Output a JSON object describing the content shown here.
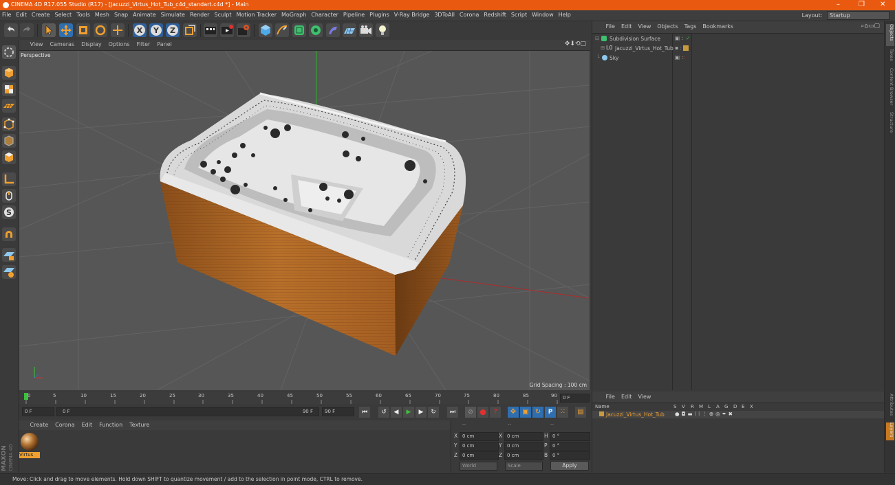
{
  "window": {
    "title": "CINEMA 4D R17.055 Studio (R17) - [Jacuzzi_Virtus_Hot_Tub_c4d_standart.c4d *] - Main",
    "controls": [
      "–",
      "❐",
      "✕"
    ]
  },
  "menu": [
    "File",
    "Edit",
    "Create",
    "Select",
    "Tools",
    "Mesh",
    "Snap",
    "Animate",
    "Simulate",
    "Render",
    "Sculpt",
    "Motion Tracker",
    "MoGraph",
    "Character",
    "Pipeline",
    "Plugins",
    "V-Ray Bridge",
    "3DToAll",
    "Corona",
    "Redshift",
    "Script",
    "Window",
    "Help"
  ],
  "layout": {
    "label": "Layout:",
    "value": "Startup"
  },
  "viewport": {
    "menu": [
      "View",
      "Cameras",
      "Display",
      "Options",
      "Filter",
      "Panel"
    ],
    "label": "Perspective",
    "grid_spacing": "Grid Spacing : 100 cm"
  },
  "timeline": {
    "ticks": [
      "0",
      "5",
      "10",
      "15",
      "20",
      "25",
      "30",
      "35",
      "40",
      "45",
      "50",
      "55",
      "60",
      "65",
      "70",
      "75",
      "80",
      "85",
      "90"
    ],
    "current_frame": "0 F"
  },
  "transport": {
    "start": "0 F",
    "range_start": "0 F",
    "range_end": "90 F",
    "end": "90 F"
  },
  "material_manager": {
    "menu": [
      "Create",
      "Corona",
      "Edit",
      "Function",
      "Texture"
    ],
    "materials": [
      {
        "name": "Virtus"
      }
    ]
  },
  "coordinates": {
    "headers": [
      "--",
      "--",
      "--"
    ],
    "rows": [
      {
        "a": "X",
        "av": "0 cm",
        "b": "X",
        "bv": "0 cm",
        "c": "H",
        "cv": "0 °"
      },
      {
        "a": "Y",
        "av": "0 cm",
        "b": "Y",
        "bv": "0 cm",
        "c": "P",
        "cv": "0 °"
      },
      {
        "a": "Z",
        "av": "0 cm",
        "b": "Z",
        "bv": "0 cm",
        "c": "B",
        "cv": "0 °"
      }
    ],
    "mode": "World",
    "scale": "Scale",
    "apply": "Apply"
  },
  "object_manager": {
    "menu": [
      "File",
      "Edit",
      "View",
      "Objects",
      "Tags",
      "Bookmarks"
    ],
    "objects": [
      {
        "name": "Subdivision Surface"
      },
      {
        "name": "Jacuzzi_Virtus_Hot_Tub"
      },
      {
        "name": "Sky"
      }
    ]
  },
  "layer_manager": {
    "menu": [
      "File",
      "Edit",
      "View"
    ],
    "columns": [
      "Name",
      "S",
      "V",
      "R",
      "M",
      "L",
      "A",
      "G",
      "D",
      "E",
      "X"
    ],
    "layers": [
      {
        "name": "Jacuzzi_Virtus_Hot_Tub"
      }
    ]
  },
  "right_tabs": [
    "Objects",
    "Takes",
    "Content Browser",
    "Structure"
  ],
  "right_tabs_bottom": [
    "Attributes",
    "Layers"
  ],
  "status": "Move: Click and drag to move elements. Hold down SHIFT to quantize movement / add to the selection in point mode, CTRL to remove.",
  "logo": "MAXON CINEMA 4D"
}
